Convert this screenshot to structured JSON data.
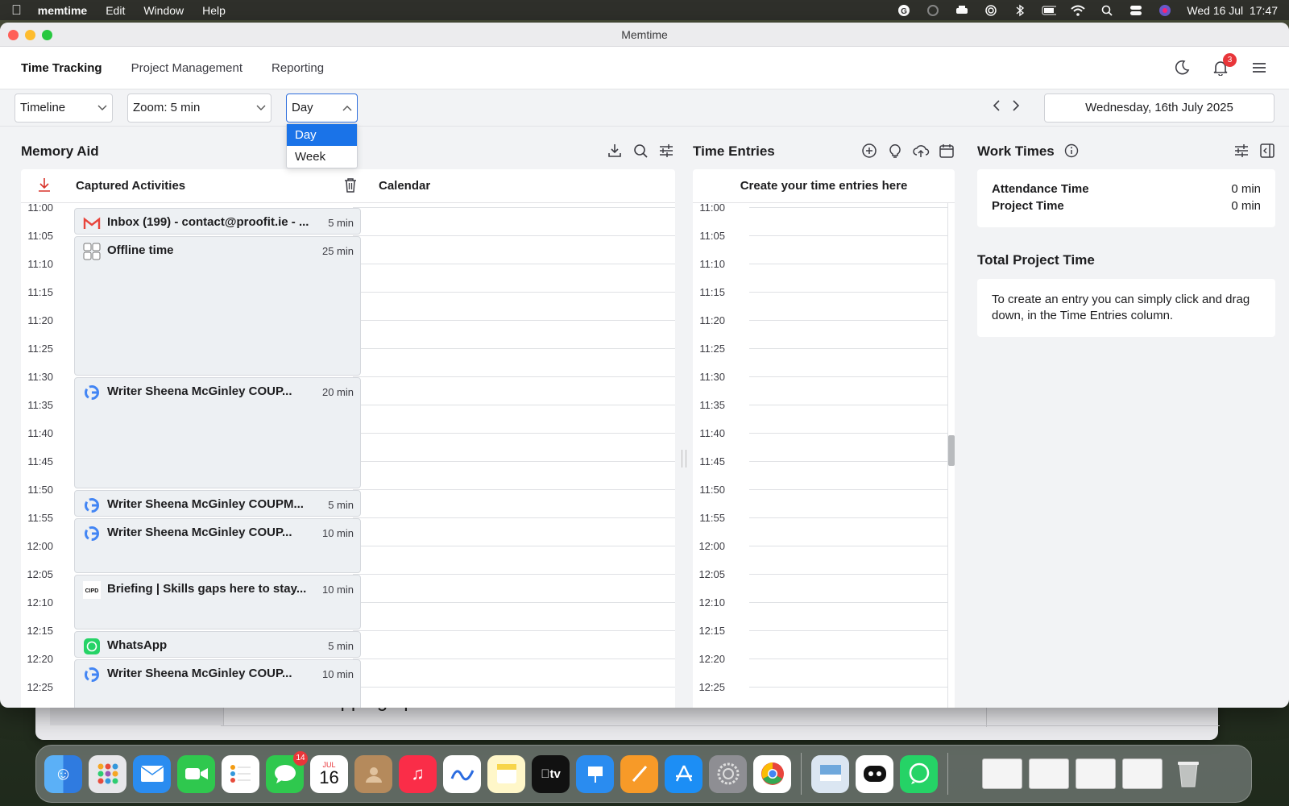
{
  "menubar": {
    "app": "memtime",
    "items": [
      "Edit",
      "Window",
      "Help"
    ],
    "datetime": "Wed 16 Jul  17:47"
  },
  "window": {
    "title": "Memtime"
  },
  "nav": {
    "tabs": [
      "Time Tracking",
      "Project Management",
      "Reporting"
    ],
    "notifications": "3"
  },
  "toolbar": {
    "view": "Timeline",
    "zoom": "Zoom: 5 min",
    "period": "Day",
    "period_options": [
      "Day",
      "Week"
    ],
    "date": "Wednesday, 16th July 2025"
  },
  "memory_aid": {
    "title": "Memory Aid",
    "captured_label": "Captured Activities",
    "calendar_label": "Calendar"
  },
  "times": [
    "11:00",
    "11:05",
    "11:10",
    "11:15",
    "11:20",
    "11:25",
    "11:30",
    "11:35",
    "11:40",
    "11:45",
    "11:50",
    "11:55",
    "12:00",
    "12:05",
    "12:10",
    "12:15",
    "12:20",
    "12:25"
  ],
  "activities": [
    {
      "title": "Inbox (199) - contact@proofit.ie - ...",
      "duration": "5 min",
      "icon": "gmail-icon",
      "slots": 1
    },
    {
      "title": "Offline time",
      "duration": "25 min",
      "icon": "offline-icon",
      "slots": 5
    },
    {
      "title": "Writer Sheena McGinley COUP...",
      "duration": "20 min",
      "icon": "google-icon",
      "slots": 4
    },
    {
      "title": "Writer Sheena McGinley COUPM...",
      "duration": "5 min",
      "icon": "google-icon",
      "slots": 1
    },
    {
      "title": "Writer Sheena McGinley COUP...",
      "duration": "10 min",
      "icon": "google-icon",
      "slots": 2
    },
    {
      "title": "Briefing | Skills gaps here to stay...",
      "duration": "10 min",
      "icon": "cipd-icon",
      "slots": 2
    },
    {
      "title": "WhatsApp",
      "duration": "5 min",
      "icon": "whatsapp-icon",
      "slots": 1
    },
    {
      "title": "Writer Sheena McGinley COUP...",
      "duration": "10 min",
      "icon": "google-icon",
      "slots": 2
    }
  ],
  "time_entries": {
    "title": "Time Entries",
    "header": "Create your time entries here"
  },
  "work_times": {
    "title": "Work Times",
    "attendance_label": "Attendance Time",
    "attendance_value": "0 min",
    "project_label": "Project Time",
    "project_value": "0 min"
  },
  "total_project_time": {
    "title": "Total Project Time",
    "message": "To create an entry you can simply click and drag down, in the Time Entries column."
  },
  "background_window": {
    "heading": "Wrapping up"
  },
  "dock": {
    "messages_badge": "14",
    "calendar_month": "JUL",
    "calendar_day": "16"
  },
  "colors": {
    "accent": "#1a73e8",
    "badge": "#e8363a"
  }
}
